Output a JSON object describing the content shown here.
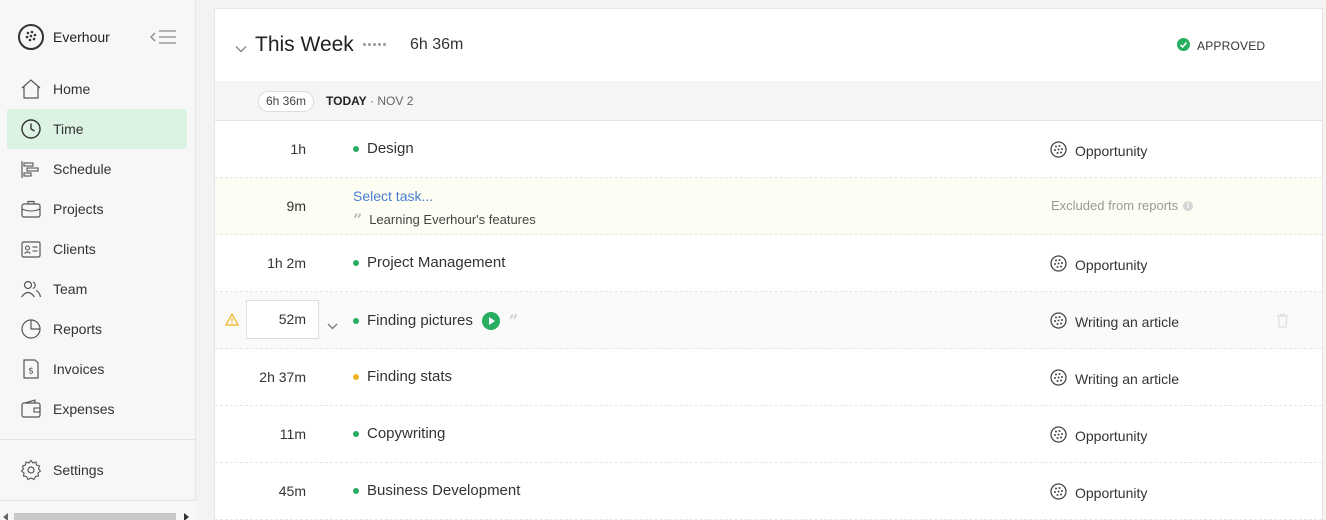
{
  "brand": {
    "name": "Everhour"
  },
  "nav": {
    "items": [
      {
        "label": "Home",
        "icon": "home-icon"
      },
      {
        "label": "Time",
        "icon": "clock-icon",
        "active": true
      },
      {
        "label": "Schedule",
        "icon": "schedule-icon"
      },
      {
        "label": "Projects",
        "icon": "briefcase-icon"
      },
      {
        "label": "Clients",
        "icon": "contact-card-icon"
      },
      {
        "label": "Team",
        "icon": "team-icon"
      },
      {
        "label": "Reports",
        "icon": "pie-chart-icon"
      },
      {
        "label": "Invoices",
        "icon": "invoice-icon"
      },
      {
        "label": "Expenses",
        "icon": "wallet-icon"
      }
    ],
    "settings": {
      "label": "Settings",
      "icon": "gear-icon"
    }
  },
  "week": {
    "title": "This Week",
    "total": "6h 36m",
    "status": "APPROVED"
  },
  "day": {
    "total": "6h 36m",
    "today": "TODAY",
    "date": "· NOV 2"
  },
  "entries": [
    {
      "duration": "1h",
      "task": "Design",
      "dot_color": "#27ae60",
      "project": "Opportunity"
    },
    {
      "duration": "9m",
      "select_task": "Select task...",
      "note": "Learning Everhour's features",
      "excluded": "Excluded from reports"
    },
    {
      "duration": "1h 2m",
      "task": "Project Management",
      "dot_color": "#27ae60",
      "project": "Opportunity"
    },
    {
      "duration": "52m",
      "task": "Finding pictures",
      "dot_color": "#27ae60",
      "project": "Writing an article"
    },
    {
      "duration": "2h 37m",
      "task": "Finding stats",
      "dot_color": "#f0b429",
      "project": "Writing an article"
    },
    {
      "duration": "11m",
      "task": "Copywriting",
      "dot_color": "#27ae60",
      "project": "Opportunity"
    },
    {
      "duration": "45m",
      "task": "Business Development",
      "dot_color": "#27ae60",
      "project": "Opportunity"
    }
  ],
  "colors": {
    "accent": "#27ae60",
    "active_nav_bg": "#dcf3e4",
    "link": "#4a7ed0",
    "warning": "#f0b429"
  }
}
